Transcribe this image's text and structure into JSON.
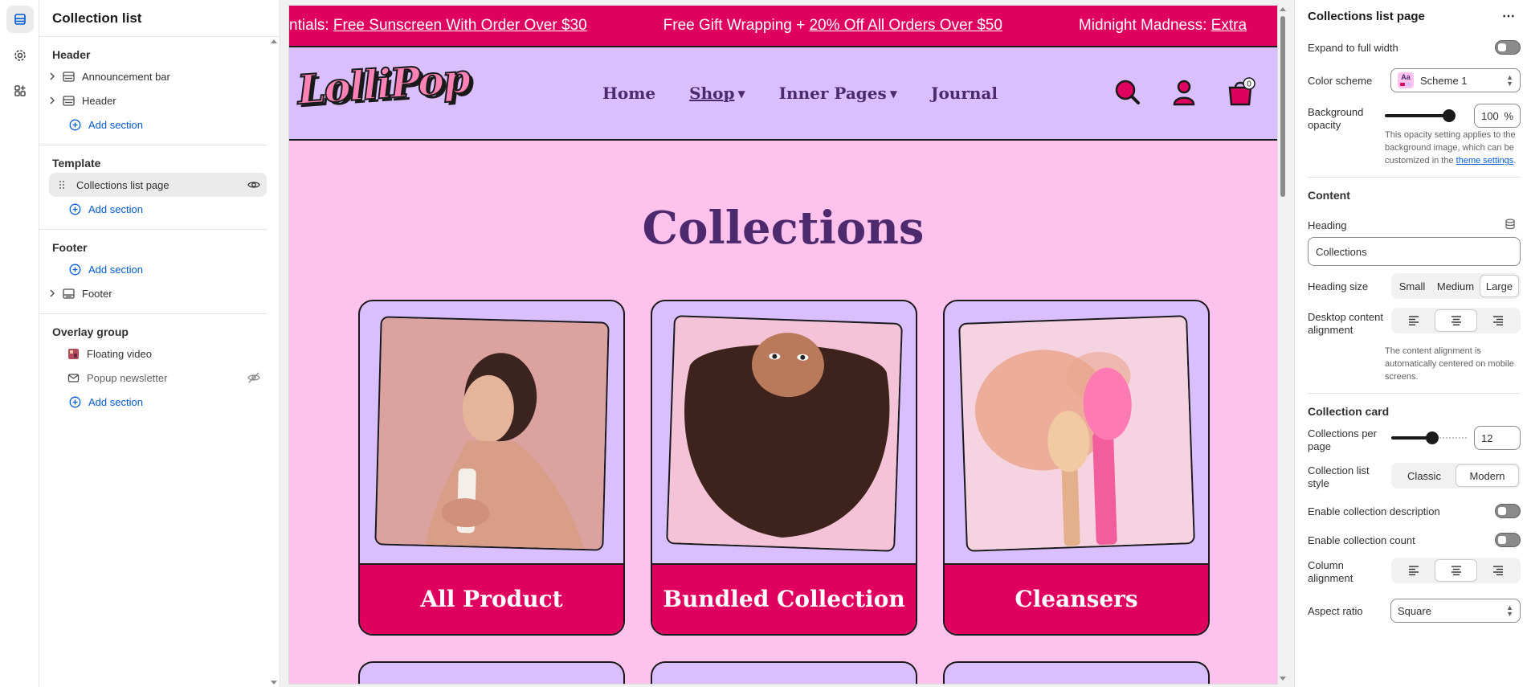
{
  "left_panel": {
    "title": "Collection list",
    "header_group": {
      "title": "Header",
      "items": [
        {
          "label": "Announcement bar"
        },
        {
          "label": "Header"
        }
      ],
      "add_label": "Add section"
    },
    "template_group": {
      "title": "Template",
      "items": [
        {
          "label": "Collections list page"
        }
      ],
      "add_label": "Add section"
    },
    "footer_group": {
      "title": "Footer",
      "add_label": "Add section",
      "items": [
        {
          "label": "Footer"
        }
      ]
    },
    "overlay_group": {
      "title": "Overlay group",
      "items": [
        {
          "label": "Floating video"
        },
        {
          "label": "Popup newsletter"
        }
      ],
      "add_label": "Add section"
    }
  },
  "preview": {
    "announcement": {
      "item1_prefix": "ntials: ",
      "item1_link": "Free Sunscreen With Order Over $30",
      "item2_prefix": "Free Gift Wrapping + ",
      "item2_link": "20% Off All Orders Over $50",
      "item3_prefix": "Midnight Madness: ",
      "item3_link": "Extra"
    },
    "logo_text": "LolliPop",
    "nav": {
      "home": "Home",
      "shop": "Shop",
      "inner_pages": "Inner Pages",
      "journal": "Journal"
    },
    "cart_count": "0",
    "heading": "Collections",
    "collections": [
      {
        "title": "All Product"
      },
      {
        "title": "Bundled Collection"
      },
      {
        "title": "Cleansers"
      }
    ]
  },
  "right_panel": {
    "title": "Collections list page",
    "expand_label": "Expand to full width",
    "color_scheme_label": "Color scheme",
    "color_scheme_value": "Scheme 1",
    "color_scheme_badge": "Aa",
    "bg_opacity_label": "Background opacity",
    "bg_opacity_value": "100",
    "bg_opacity_unit": "%",
    "bg_opacity_level": 1.0,
    "bg_opacity_help": "This opacity setting applies to the background image, which can be customized in the",
    "bg_opacity_help_link": "theme settings",
    "bg_opacity_help_end": ".",
    "content_title": "Content",
    "heading_label": "Heading",
    "heading_value": "Collections",
    "heading_size_label": "Heading size",
    "heading_size_options": [
      "Small",
      "Medium",
      "Large"
    ],
    "heading_size_selected": "Large",
    "desktop_alignment_label": "Desktop content alignment",
    "alignment_help": "The content alignment is automatically centered on mobile screens.",
    "collection_card_title": "Collection card",
    "per_page_label": "Collections per page",
    "per_page_value": "12",
    "list_style_label": "Collection list style",
    "list_style_options": [
      "Classic",
      "Modern"
    ],
    "list_style_selected": "Modern",
    "enable_desc_label": "Enable collection description",
    "enable_count_label": "Enable collection count",
    "column_alignment_label": "Column alignment",
    "aspect_ratio_label": "Aspect ratio",
    "aspect_ratio_value": "Square"
  },
  "colors": {
    "brand_pink": "#e0005f",
    "lavender": "#d9bfff",
    "page_bg": "#ffc2ed",
    "heading_purple": "#4d2a6e",
    "link_blue": "#005bd3"
  }
}
